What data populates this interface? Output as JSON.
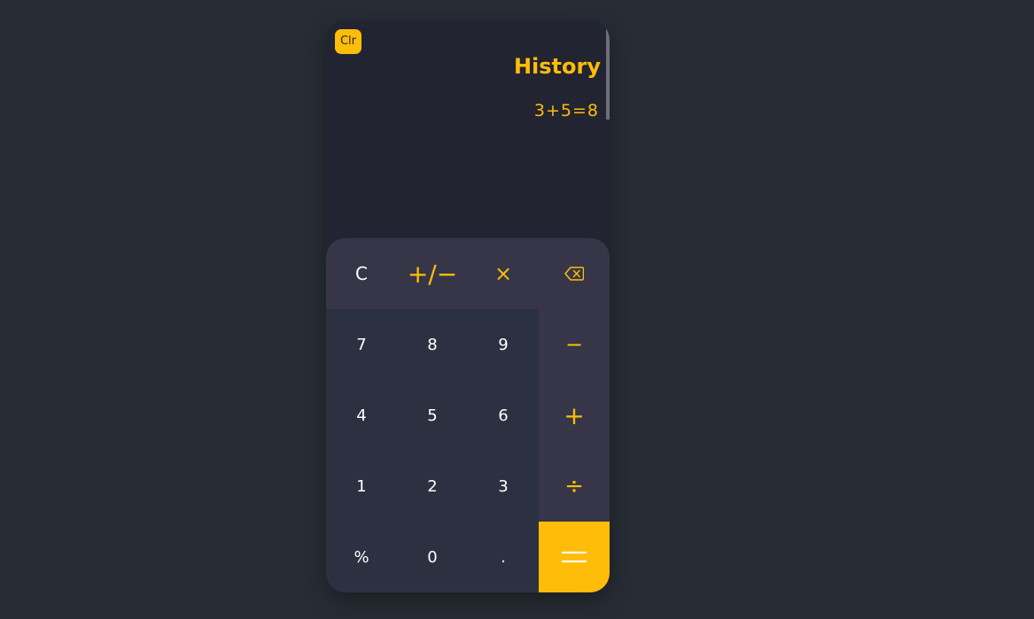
{
  "history": {
    "clear_label": "Clr",
    "title": "History",
    "entries": [
      "3+5=8"
    ]
  },
  "keypad": {
    "clear": "C",
    "sign": "+/−",
    "multiply": "×",
    "backspace_icon": "backspace-icon",
    "digits": {
      "d7": "7",
      "d8": "8",
      "d9": "9",
      "d4": "4",
      "d5": "5",
      "d6": "6",
      "d1": "1",
      "d2": "2",
      "d3": "3",
      "d0": "0"
    },
    "percent": "%",
    "decimal": ".",
    "minus": "−",
    "plus": "+",
    "divide": "÷",
    "equals_icon": "equals-icon"
  },
  "colors": {
    "background": "#272d35",
    "accent": "#ffbd0a",
    "display_bg": "#222431",
    "keypad_bg": "#2c3142",
    "operator_bg": "#363648"
  }
}
